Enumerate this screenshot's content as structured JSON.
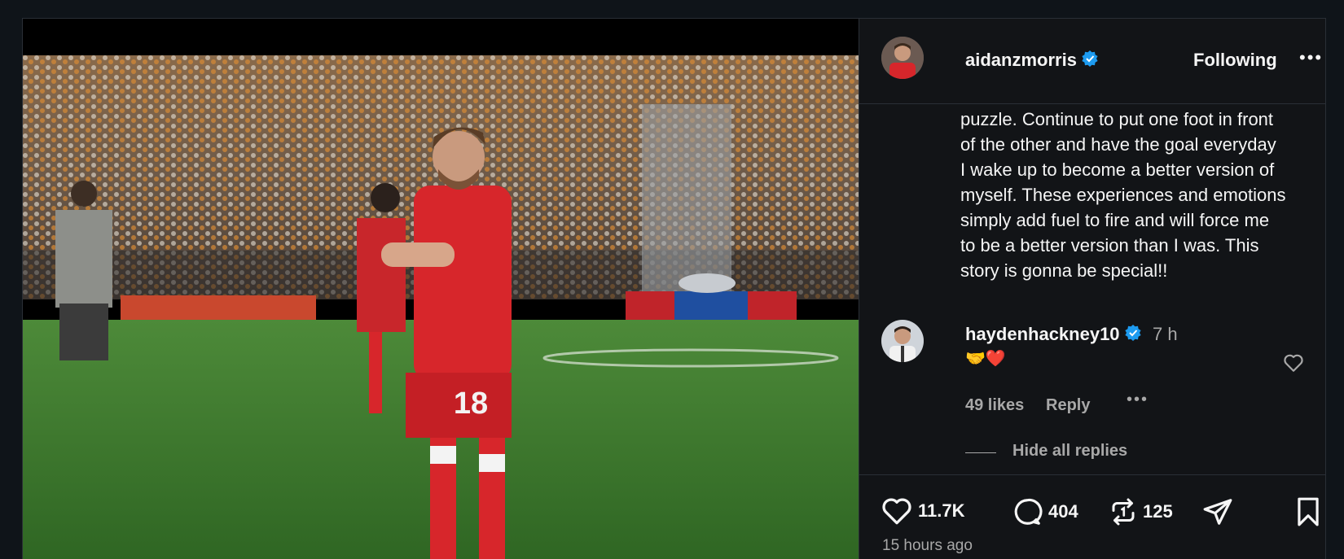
{
  "post": {
    "author": "aidanzmorris",
    "follow_label": "Following",
    "more_label": "•••",
    "caption_lines": [
      "puzzle. Continue to put one foot in front",
      "of the other and have the goal everyday",
      "I wake up to become a better version of",
      "myself. These experiences and emotions",
      "simply add fuel to fire and will force me",
      "to be a better version than I was. This",
      "story is gonna be special!!"
    ]
  },
  "comment": {
    "user": "haydenhackney10",
    "time": "7 h",
    "text": "🤝❤️",
    "likes": "49 likes",
    "reply_label": "Reply",
    "more_label": "•••",
    "hide_replies_label": "Hide all replies"
  },
  "actions": {
    "likes": "11.7K",
    "comments": "404",
    "reposts": "125"
  },
  "timestamp": "15 hours ago",
  "colors": {
    "accent_verified": "#1d9bf0",
    "jersey_red": "#d7262b",
    "pitch_green": "#3f7d2f"
  },
  "photo": {
    "shirt_number": "18"
  }
}
